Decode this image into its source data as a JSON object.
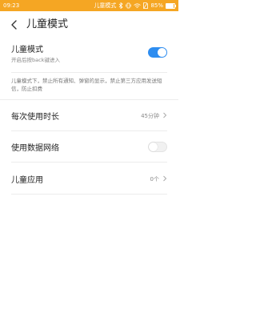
{
  "status_bar": {
    "time": "09:23",
    "mode_label": "儿童模式",
    "battery_text": "85%",
    "battery_level": 0.85,
    "icons": [
      "bluetooth-icon",
      "vibrate-icon",
      "wifi-icon",
      "no-sim-icon",
      "battery-icon"
    ]
  },
  "header": {
    "title": "儿童模式",
    "back_icon": "back-chevron-icon"
  },
  "kids_mode": {
    "label": "儿童模式",
    "subtitle": "开启后按back键进入",
    "enabled": true,
    "description": "儿童模式下，禁止所有通知、弹窗的显示，禁止第三方应用发送短信，防止扣费"
  },
  "usage_time": {
    "label": "每次使用时长",
    "value": "45分钟"
  },
  "mobile_data": {
    "label": "使用数据网络",
    "enabled": false
  },
  "kids_apps": {
    "label": "儿童应用",
    "value": "0个"
  },
  "colors": {
    "status_bar": "#f5a623",
    "toggle_on": "#2e8df0"
  }
}
